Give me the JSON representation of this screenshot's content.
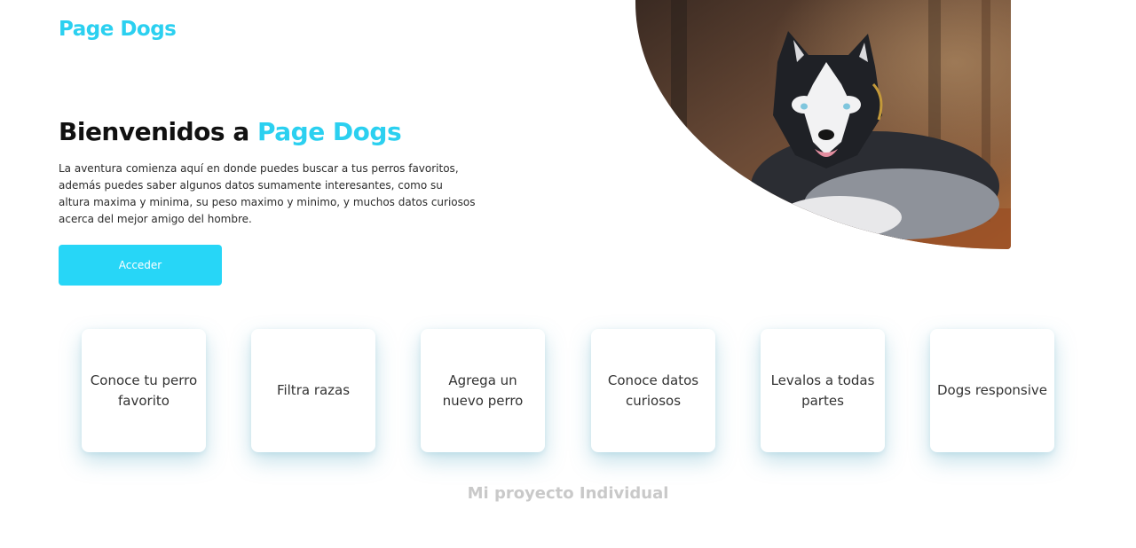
{
  "header": {
    "logo": "Page Dogs"
  },
  "hero": {
    "title_prefix": "Bienvenidos a ",
    "title_accent": "Page Dogs",
    "description": "La aventura comienza aquí en donde puedes buscar a tus perros favoritos, además puedes saber algunos datos sumamente interesantes, como su altura maxima y minima, su peso maximo y minimo, y muchos datos curiosos acerca del mejor amigo del hombre.",
    "button_label": "Acceder"
  },
  "features": [
    {
      "label": "Conoce tu perro favorito"
    },
    {
      "label": "Filtra razas"
    },
    {
      "label": "Agrega un nuevo perro"
    },
    {
      "label": "Conoce datos curiosos"
    },
    {
      "label": "Levalos a todas partes"
    },
    {
      "label": "Dogs responsive"
    }
  ],
  "footer": {
    "text": "Mi proyecto Individual"
  },
  "colors": {
    "accent": "#2bd0f0",
    "button": "#27d6f7"
  }
}
